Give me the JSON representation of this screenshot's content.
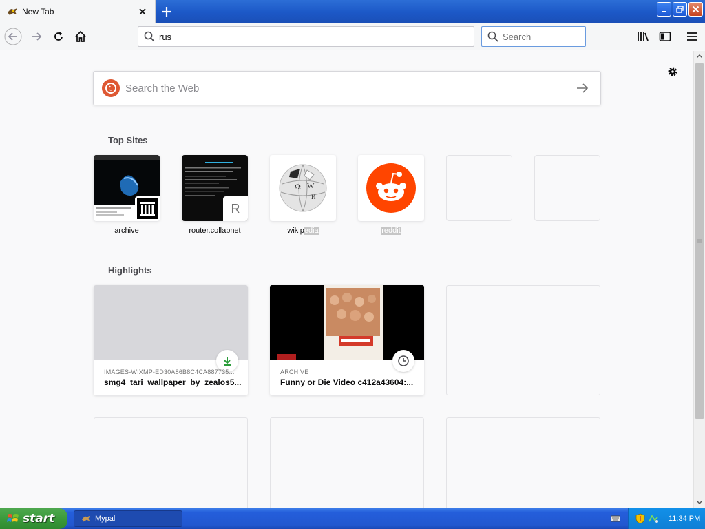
{
  "window": {
    "tab_title": "New Tab",
    "new_tab_symbol": "+"
  },
  "toolbar": {
    "url_value": "rus",
    "search_placeholder": "Search"
  },
  "newtab": {
    "web_search_placeholder": "Search the Web",
    "top_sites_title": "Top Sites",
    "top_sites": [
      {
        "label": "archive"
      },
      {
        "label": "router.collabnet",
        "fallback_letter": "R"
      },
      {
        "label_plain": "wikip",
        "label_selected": "edia"
      },
      {
        "label_selected": "reddit"
      }
    ],
    "highlights_title": "Highlights",
    "highlights": [
      {
        "context": "IMAGES-WIXMP-ED30A86B8C4CA887735...",
        "title": "smg4_tari_wallpaper_by_zealos5...",
        "badge": "download-icon"
      },
      {
        "context": "ARCHIVE",
        "title": "Funny or Die Video c412a43604:...",
        "badge": "clock-icon"
      }
    ]
  },
  "taskbar": {
    "start_label": "start",
    "task_item": "Mypal",
    "clock": "11:34 PM"
  },
  "colors": {
    "xp_blue": "#245edb",
    "start_green": "#3b9a3b",
    "reddit_orange": "#ff4500",
    "ddg_orange": "#de5833",
    "download_green": "#2a9d3a"
  }
}
